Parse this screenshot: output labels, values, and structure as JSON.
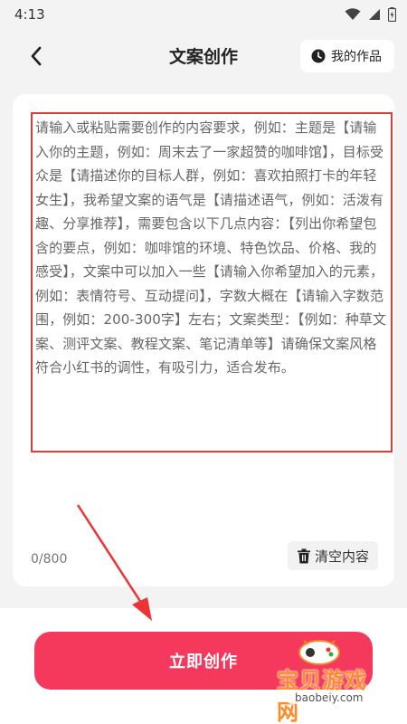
{
  "status_bar": {
    "time": "4:13"
  },
  "header": {
    "title": "文案创作",
    "my_works_label": "我的作品"
  },
  "editor": {
    "prompt_text": "请输入或粘贴需要创作的内容要求，例如：主题是【请输入你的主题，例如：周末去了一家超赞的咖啡馆】，目标受众是【请描述你的目标人群，例如：喜欢拍照打卡的年轻女生】，我希望文案的语气是【请描述语气，例如：活泼有趣、分享推荐】，需要包含以下几点内容：【列出你希望包含的要点，例如：咖啡馆的环境、特色饮品、价格、我的感受】，文案中可以加入一些【请输入你希望加入的元素，例如：表情符号、互动提问】，字数大概在【请输入字数范围，例如：200-300字】左右；文案类型：【例如：种草文案、测评文案、教程文案、笔记清单等】请确保文案风格符合小红书的调性，有吸引力，适合发布。",
    "char_count": "0/800",
    "clear_label": "清空内容"
  },
  "actions": {
    "create_label": "立即创作"
  },
  "watermark": {
    "text": "宝贝游戏网",
    "url": "baobeiy.com"
  },
  "colors": {
    "accent": "#f5395c",
    "highlight_border": "#e23a3a",
    "background": "#f3f3f3"
  },
  "icons": {
    "back": "chevron-left-icon",
    "works": "clock-icon",
    "clear": "trash-icon",
    "wifi": "wifi-icon",
    "signal": "signal-icon",
    "battery": "battery-icon"
  }
}
